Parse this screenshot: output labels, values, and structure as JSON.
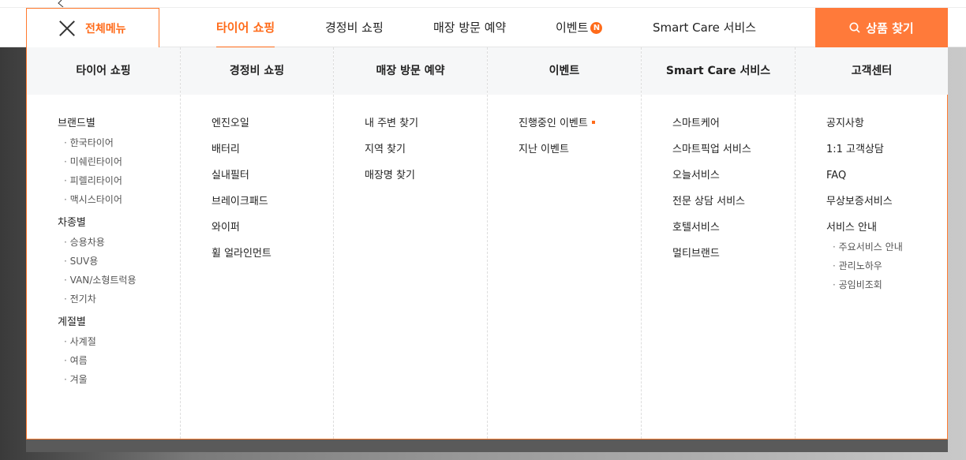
{
  "header": {
    "all_menu_label": "전체메뉴",
    "nav": [
      {
        "label": "타이어 쇼핑",
        "active": true
      },
      {
        "label": "경정비 쇼핑",
        "active": false
      },
      {
        "label": "매장 방문 예약",
        "active": false
      },
      {
        "label": "이벤트",
        "active": false,
        "badge": "N"
      },
      {
        "label": "Smart Care 서비스",
        "active": false
      }
    ],
    "search_label": "상품 찾기"
  },
  "colors": {
    "accent": "#ff6b1a",
    "search_bg": "#ff7a3a"
  },
  "panel": {
    "columns": [
      {
        "title": "타이어 쇼핑",
        "groups": [
          {
            "title": "브랜드별",
            "subs": [
              "한국타이어",
              "미쉐린타이어",
              "피렐리타이어",
              "맥시스타이어"
            ]
          },
          {
            "title": "차종별",
            "subs": [
              "승용차용",
              "SUV용",
              "VAN/소형트럭용",
              "전기차"
            ]
          },
          {
            "title": "계절별",
            "subs": [
              "사계절",
              "여름",
              "겨울"
            ]
          }
        ]
      },
      {
        "title": "경정비 쇼핑",
        "items": [
          "엔진오일",
          "배터리",
          "실내필터",
          "브레이크패드",
          "와이퍼",
          "휠 얼라인먼트"
        ]
      },
      {
        "title": "매장 방문 예약",
        "items": [
          "내 주변 찾기",
          "지역 찾기",
          "매장명 찾기"
        ]
      },
      {
        "title": "이벤트",
        "items": [
          "진행중인 이벤트",
          "지난 이벤트"
        ]
      },
      {
        "title": "Smart Care 서비스",
        "items": [
          "스마트케어",
          "스마트픽업 서비스",
          "오늘서비스",
          "전문 상담 서비스",
          "호텔서비스",
          "멀티브랜드"
        ]
      },
      {
        "title": "고객센터",
        "items": [
          "공지사항",
          "1:1 고객상담",
          "FAQ",
          "무상보증서비스"
        ],
        "group": {
          "title": "서비스 안내",
          "subs": [
            "주요서비스 안내",
            "관리노하우",
            "공임비조회"
          ]
        }
      }
    ]
  }
}
